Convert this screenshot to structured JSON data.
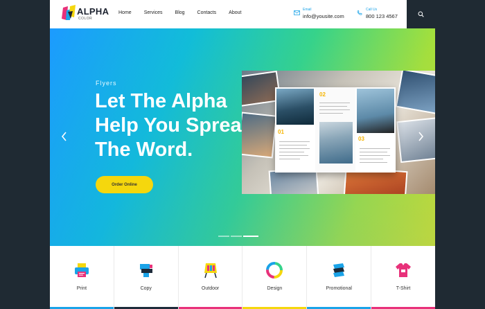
{
  "logo": {
    "text": "ALPHA",
    "sub": "COLOR"
  },
  "nav": {
    "items": [
      "Home",
      "Services",
      "Blog",
      "Contacts",
      "About"
    ]
  },
  "contact": {
    "email_label": "Email",
    "email": "info@yousite.com",
    "phone_label": "Call Us",
    "phone": "800 123 4567"
  },
  "hero": {
    "eyebrow": "Flyers",
    "headline_lines": [
      "Let The Alpha",
      "Help You Spread",
      "The Word."
    ],
    "button": "Order Online",
    "slides": 3,
    "active_slide": 2
  },
  "brochure": {
    "numbers": [
      "01",
      "02",
      "03"
    ]
  },
  "services": [
    {
      "label": "Print",
      "icon": "printer-icon",
      "color": "#1aa3e8"
    },
    {
      "label": "Copy",
      "icon": "copier-icon",
      "color": "#1d2b3a"
    },
    {
      "label": "Outdoor",
      "icon": "billboard-icon",
      "color": "#e8317a"
    },
    {
      "label": "Design",
      "icon": "color-wheel-icon",
      "color": "#f5d70d"
    },
    {
      "label": "Promotional",
      "icon": "stack-icon",
      "color": "#1aa3e8"
    },
    {
      "label": "T-Shirt",
      "icon": "tshirt-icon",
      "color": "#e8317a"
    }
  ],
  "colors": {
    "accent_blue": "#1aa3e8",
    "accent_yellow": "#f5d70d",
    "accent_pink": "#e8317a",
    "dark": "#1f2a33"
  }
}
